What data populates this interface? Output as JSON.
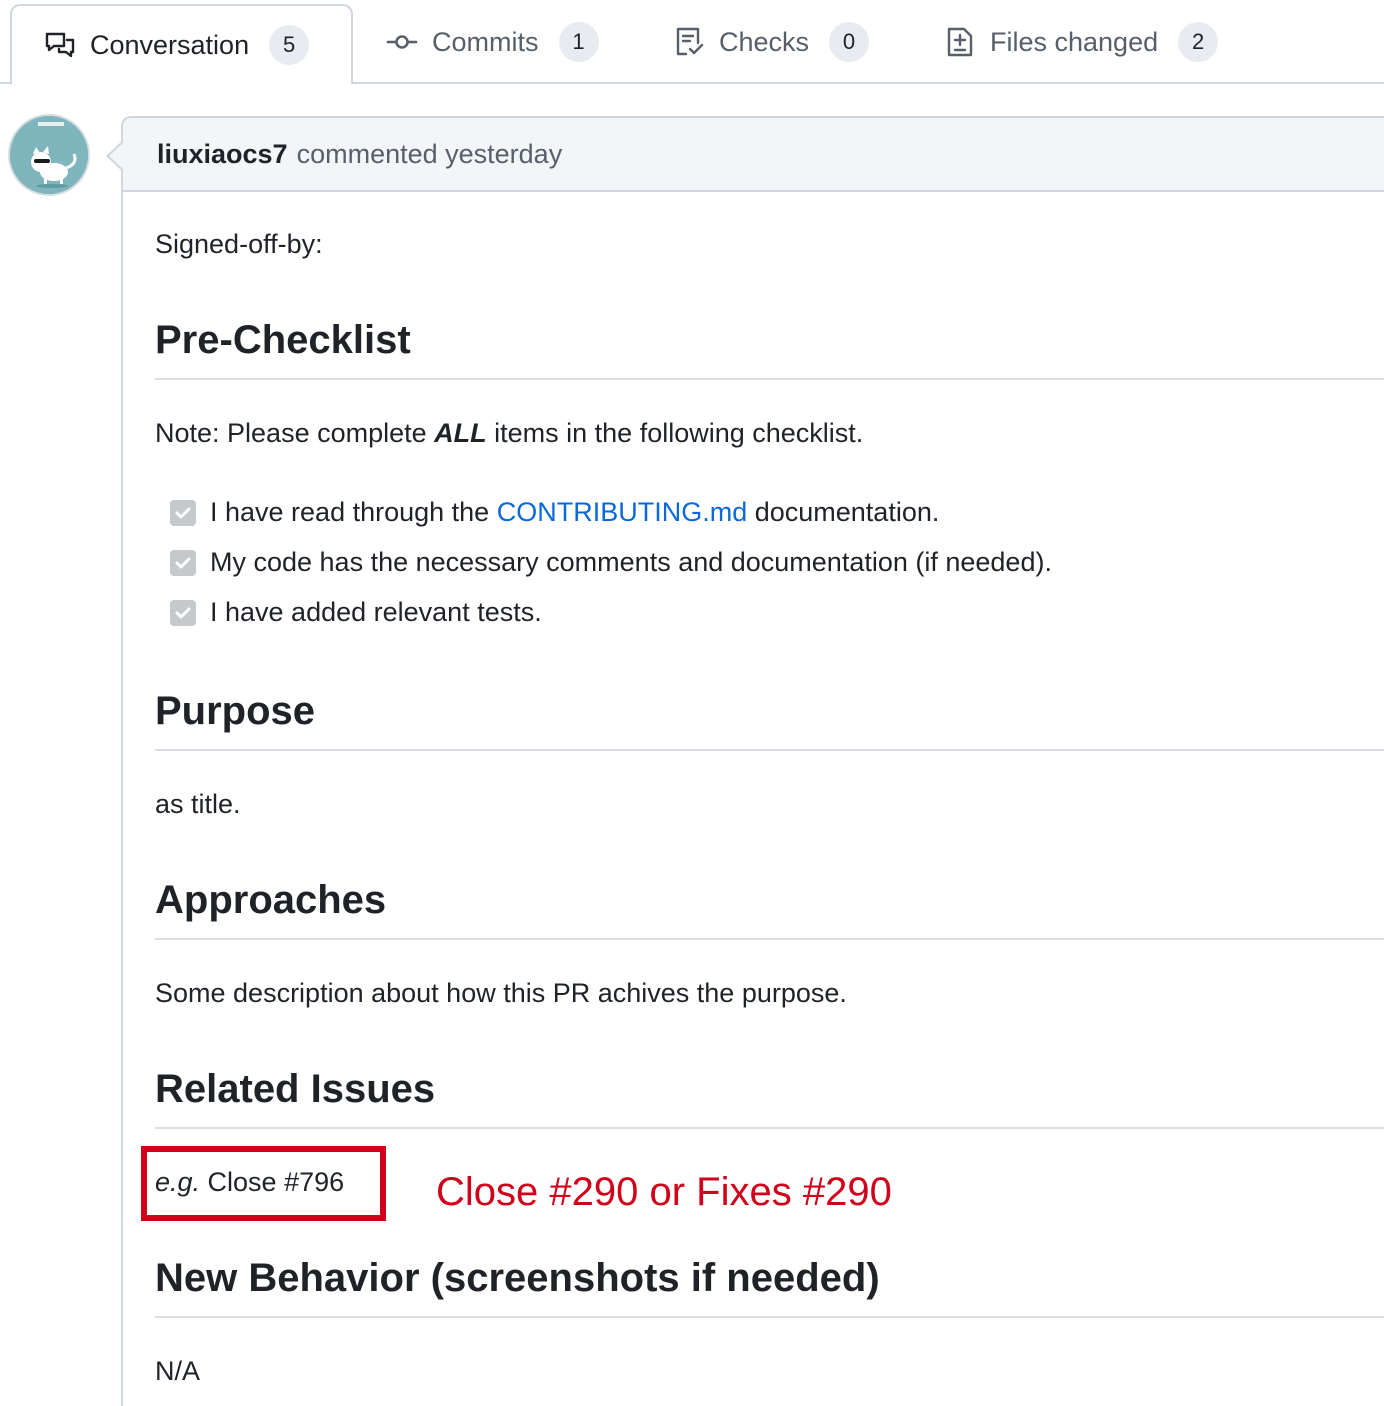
{
  "tabs": [
    {
      "label": "Conversation",
      "count": "5",
      "icon": "comment-discussion-icon"
    },
    {
      "label": "Commits",
      "count": "1",
      "icon": "git-commit-icon"
    },
    {
      "label": "Checks",
      "count": "0",
      "icon": "checklist-icon"
    },
    {
      "label": "Files changed",
      "count": "2",
      "icon": "file-diff-icon"
    }
  ],
  "comment": {
    "author": "liuxiaocs7",
    "action": "commented yesterday"
  },
  "body": {
    "signed_off": "Signed-off-by:",
    "pre_checklist": {
      "heading": "Pre-Checklist",
      "note_prefix": "Note: Please complete ",
      "note_emphasis": "ALL",
      "note_suffix": " items in the following checklist.",
      "tasks": [
        {
          "prefix": "I have read through the ",
          "link": "CONTRIBUTING.md",
          "suffix": " documentation.",
          "checked": true
        },
        {
          "text": "My code has the necessary comments and documentation (if needed).",
          "checked": true
        },
        {
          "text": "I have added relevant tests.",
          "checked": true
        }
      ]
    },
    "purpose": {
      "heading": "Purpose",
      "text": "as title."
    },
    "approaches": {
      "heading": "Approaches",
      "text": "Some description about how this PR achives the purpose."
    },
    "related_issues": {
      "heading": "Related Issues",
      "eg": "e.g.",
      "text": " Close #796"
    },
    "new_behavior": {
      "heading": "New Behavior (screenshots if needed)",
      "text": "N/A"
    }
  },
  "annotation": {
    "text": "Close #290 or Fixes #290",
    "color": "#d0021b"
  },
  "colors": {
    "link": "#0969da",
    "border": "#d0d7de",
    "header_bg": "#f3f6f8"
  }
}
